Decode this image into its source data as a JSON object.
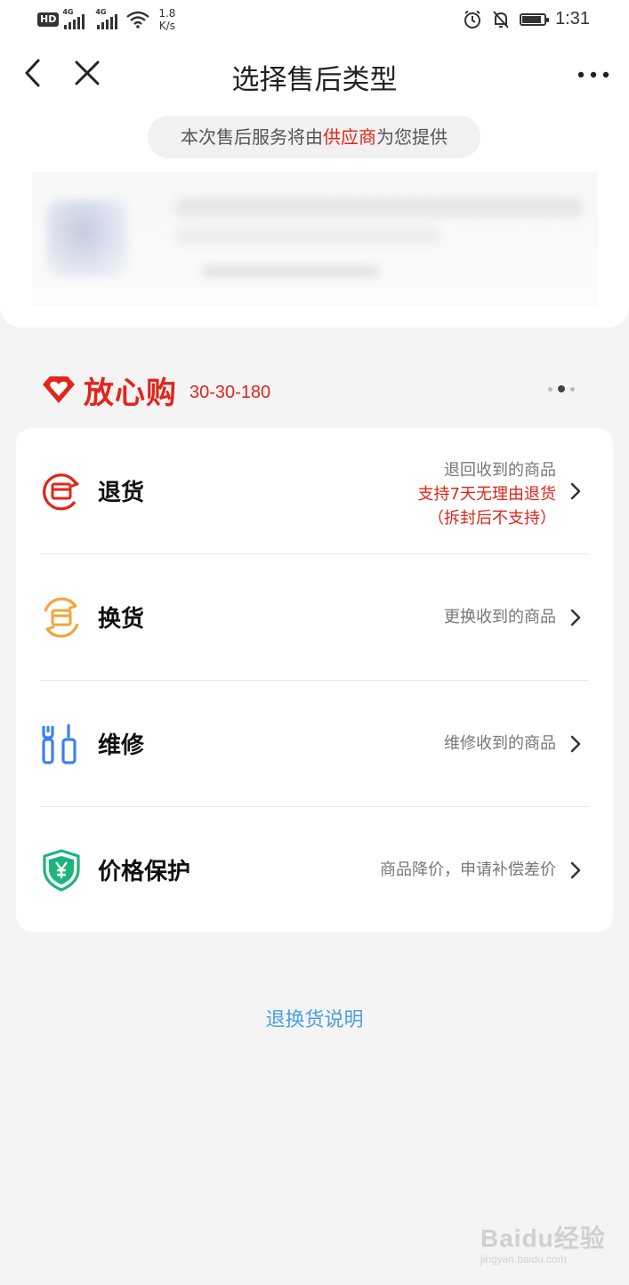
{
  "status_bar": {
    "hd": "HD",
    "network_left": "4G",
    "network_right": "4G",
    "speed_value": "1.8",
    "speed_unit": "K/s",
    "time": "1:31",
    "battery_level": 0.9
  },
  "nav": {
    "title": "选择售后类型"
  },
  "supplier_notice": {
    "prefix": "本次售后服务将由",
    "highlight": "供应商",
    "suffix": "为您提供"
  },
  "assured": {
    "brand": "放心购",
    "policy": "30-30-180",
    "page_dots": 3,
    "active_dot": 2
  },
  "options": [
    {
      "label": "退货",
      "desc_lines": [
        "退回收到的商品",
        "支持7天无理由退货",
        "（拆封后不支持）"
      ],
      "icon": "return-box-icon"
    },
    {
      "label": "换货",
      "desc_lines": [
        "更换收到的商品"
      ],
      "icon": "exchange-box-icon"
    },
    {
      "label": "维修",
      "desc_lines": [
        "维修收到的商品"
      ],
      "icon": "repair-tools-icon"
    },
    {
      "label": "价格保护",
      "desc_lines": [
        "商品降价，申请补偿差价"
      ],
      "icon": "price-shield-icon"
    }
  ],
  "footer_link": "退换货说明",
  "watermark": {
    "brand": "Baidu经验",
    "url": "jingyan.baidu.com"
  },
  "colors": {
    "accent_red": "#e1251b",
    "orange": "#f5a33a",
    "blue": "#3d7ff0",
    "green": "#1cb57a",
    "link_blue": "#4a9fe0"
  }
}
